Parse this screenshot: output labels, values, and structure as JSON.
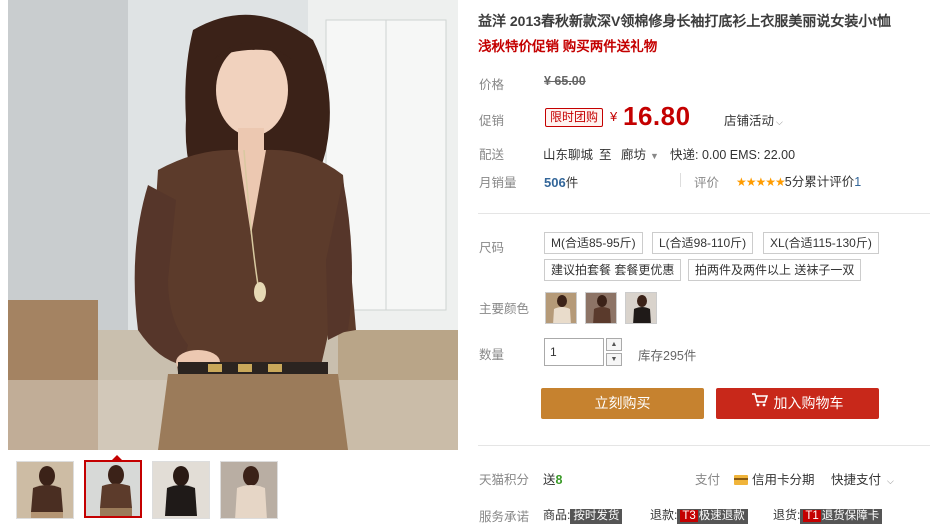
{
  "product": {
    "title": "益洋 2013春秋新款深V领棉修身长袖打底衫上衣服美丽说女装小t恤",
    "subtitle": "浅秋特价促销 购买两件送礼物"
  },
  "price": {
    "label": "价格",
    "original": "¥ 65.00",
    "promo_label": "促销",
    "promo_badge": "限时团购",
    "currency": "¥",
    "promo_price": "16.80",
    "store_activity": "店铺活动"
  },
  "shipping": {
    "label": "配送",
    "from": "山东聊城",
    "to": "至",
    "destination": "廊坊",
    "fees": "快递: 0.00 EMS: 22.00"
  },
  "sales": {
    "label": "月销量",
    "count": "506",
    "unit": "件",
    "rating_label": "评价",
    "stars": "★★★★★",
    "score": "5分",
    "reviews_text": "累计评价",
    "reviews_count": "1",
    "rating_value": 5
  },
  "sizes": {
    "label": "尺码",
    "options": [
      "M(合适85-95斤)",
      "L(合适98-110斤)",
      "XL(合适115-130斤)",
      "建议拍套餐 套餐更优惠",
      "拍两件及两件以上 送袜子一双"
    ]
  },
  "colors": {
    "label": "主要颜色",
    "swatch_colors": [
      "#b59a78",
      "#5a3a2c",
      "#d9d3cc"
    ]
  },
  "quantity": {
    "label": "数量",
    "value": "1",
    "stock": "库存295件"
  },
  "actions": {
    "buy_now": "立刻购买",
    "add_cart": "加入购物车"
  },
  "points": {
    "label": "天猫积分",
    "text": "送",
    "value": "8"
  },
  "payment": {
    "label": "支付",
    "credit": "信用卡分期",
    "quick": "快捷支付"
  },
  "service": {
    "label": "服务承诺",
    "items": [
      {
        "prefix": "商品:",
        "lead": "",
        "tag": "按时发货"
      },
      {
        "prefix": "退款:",
        "lead": "T3",
        "tag": "极速退款"
      },
      {
        "prefix": "退货:",
        "lead": "T1",
        "tag": "退货保障卡"
      }
    ]
  },
  "colors_theme": {
    "accent_red": "#c40000",
    "buy_button": "#c6822f",
    "cart_button": "#c8281a"
  },
  "icons": [
    "chevron-down-icon",
    "cart-icon",
    "credit-card-icon",
    "star-icon"
  ]
}
